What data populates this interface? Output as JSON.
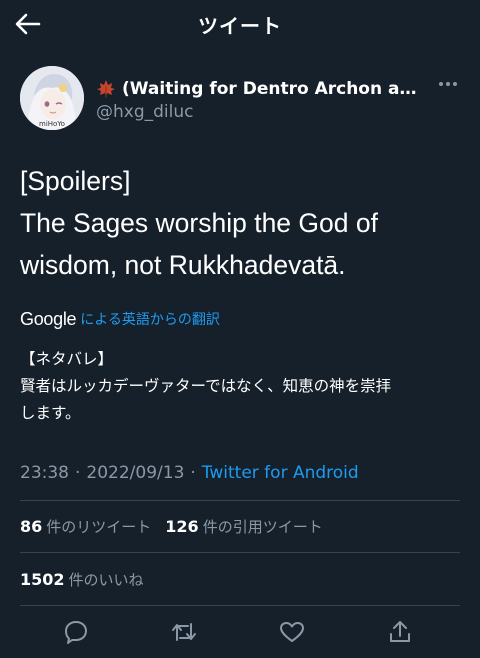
{
  "header": {
    "title": "ツイート",
    "back_icon": "arrow-left-icon"
  },
  "author": {
    "leaf_icon": "maple-leaf-icon",
    "display_name": "(Waiting for Dentro Archon and...",
    "handle": "@hxg_diluc",
    "avatar_label": "miHoYo"
  },
  "tweet": {
    "lines": [
      "[Spoilers]",
      "The Sages worship the God of",
      "wisdom, not Rukkhadevatā."
    ]
  },
  "translation": {
    "google_logo": "Google",
    "link": "による英語からの翻訳",
    "lines": [
      "【ネタバレ】",
      "賢者はルッカデーヴァターではなく、知恵の神を崇拝",
      "します。"
    ]
  },
  "meta": {
    "time": "23:38",
    "separator1": "·",
    "date": "2022/09/13",
    "separator2": "·",
    "source": "Twitter for Android"
  },
  "stats": {
    "retweets": "86",
    "retweets_label": "件のリツイート",
    "quotes": "126",
    "quotes_label": "件の引用ツイート",
    "likes": "1502",
    "likes_label": "件のいいね"
  },
  "colors": {
    "background": "#15202b",
    "accent": "#1d9bf0",
    "muted": "#8b98a5",
    "divider": "#38444d"
  }
}
